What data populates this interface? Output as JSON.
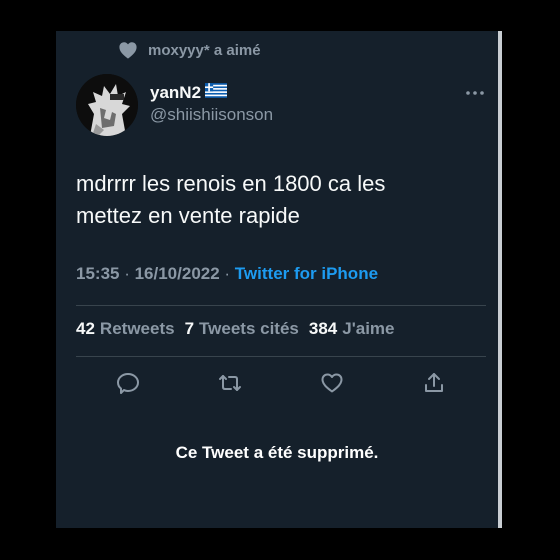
{
  "liked_by": {
    "text": "moxyyy* a aimé"
  },
  "author": {
    "display_name": "yanN2",
    "flag": "Greek flag",
    "handle": "@shiishiisonson"
  },
  "tweet": {
    "text_line1": "mdrrrr les renois en 1800 ca les",
    "text_line2": "mettez en vente rapide"
  },
  "meta": {
    "time": "15:35",
    "dot1": " · ",
    "date": "16/10/2022",
    "dot2": " · ",
    "source": "Twitter for iPhone"
  },
  "stats": {
    "retweets_count": "42",
    "retweets_label": "Retweets",
    "quotes_count": "7",
    "quotes_label": "Tweets cités",
    "likes_count": "384",
    "likes_label": "J'aime"
  },
  "actions": {
    "icons": [
      "reply-icon",
      "retweet-icon",
      "like-icon",
      "share-icon"
    ]
  },
  "notice": {
    "text": "Ce Tweet a été supprimé."
  },
  "colors": {
    "background": "#15202b",
    "primary_text": "#f7f9f9",
    "secondary_text": "#8b98a5",
    "accent": "#1d9bf0",
    "divider": "#38444d"
  }
}
